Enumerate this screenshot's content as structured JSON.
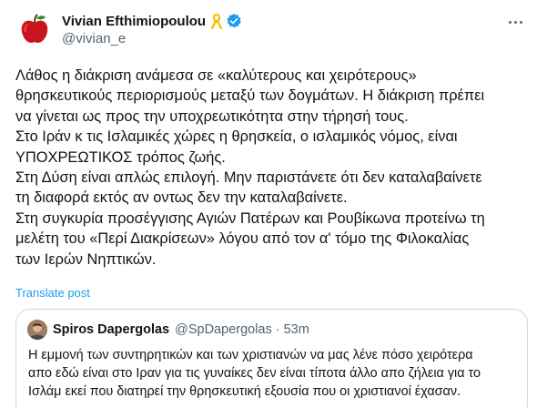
{
  "author": {
    "display_name": "Vivian Efthimiopoulou",
    "handle": "@vivian_e",
    "avatar_icon": "red-apple-avatar",
    "ribbon_icon": "yellow-ribbon-icon",
    "verified_icon": "verified-badge-icon",
    "verified_color": "#1d9bf0"
  },
  "tweet": {
    "lines": [
      "Λάθος η διάκριση ανάμεσα σε «καλύτερους και χειρότερους»",
      "θρησκευτικούς περιορισμούς μεταξύ των δογμάτων. Η διάκριση πρέπει",
      "να γίνεται ως προς την υποχρεωτικότητα στην τήρησή τους.",
      "Στο Ιράν κ τις Ισλαμικές χώρες η θρησκεία, ο ισλαμικός νόμος, είναι",
      "ΥΠΟΧΡΕΩΤΙΚΟΣ τρόπος ζωής.",
      "Στη Δύση είναι απλώς επιλογή. Μην παριστάνετε ότι δεν καταλαβαίνετε",
      "τη διαφορά εκτός αν οντως δεν την καταλαβαίνετε.",
      "Στη συγκυρία προσέγγισης Αγιών Πατέρων και Ρουβίκωνα προτείνω τη",
      "μελέτη του «Περί Διακρίσεων» λόγου από τον α' τόμο της Φιλοκαλίας",
      "των Ιερών Νηπτικών."
    ],
    "translate_label": "Translate post"
  },
  "quote": {
    "display_name": "Spiros Dapergolas",
    "handle": "@SpDapergolas",
    "separator": "·",
    "time": "53m",
    "lines": [
      "Η εμμονή των συντηρητικών και των χριστιανών να μας λένε πόσο χειρότερα",
      "απο εδώ είναι στο Ιραν για τις γυναίκες δεν είναι τίποτα άλλο απο ζήλεια για το",
      "Ισλάμ εκεί που διατηρεί την θρησκευτική εξουσία που οι χριστιανοί έχασαν."
    ]
  },
  "colors": {
    "text": "#0f1419",
    "secondary": "#536471",
    "link": "#1d9bf0",
    "border": "#cfd9de"
  }
}
